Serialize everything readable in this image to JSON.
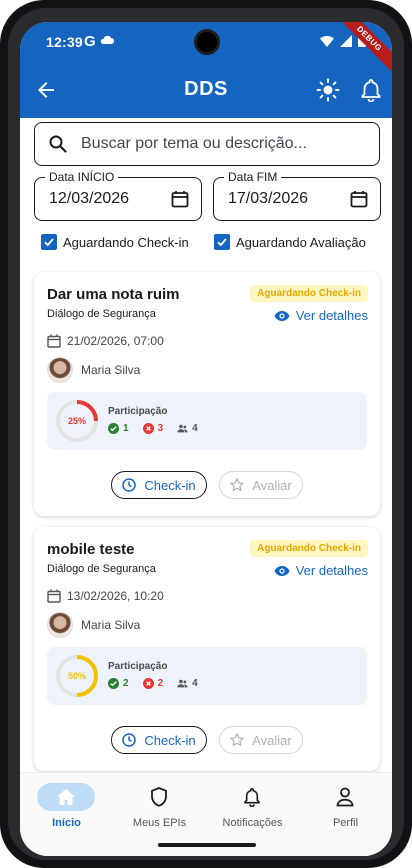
{
  "status_bar": {
    "time": "12:39",
    "carrier_letter": "G",
    "debug_label": "DEBUG"
  },
  "app_bar": {
    "title": "DDS"
  },
  "search": {
    "placeholder": "Buscar por tema ou descrição..."
  },
  "filters": {
    "start_date": {
      "label": "Data INÍCIO",
      "value": "12/03/2026"
    },
    "end_date": {
      "label": "Data FIM",
      "value": "17/03/2026"
    },
    "checkboxes": [
      {
        "label": "Aguardando Check-in",
        "checked": true
      },
      {
        "label": "Aguardando Avaliação",
        "checked": true
      }
    ]
  },
  "cards": [
    {
      "title": "Dar uma nota ruim",
      "subtitle": "Diálogo de Segurança",
      "status": "Aguardando Check-in",
      "details_label": "Ver detalhes",
      "datetime": "21/02/2026, 07:00",
      "person": "Maria Silva",
      "participation": {
        "title": "Participação",
        "percent_label": "25%",
        "percent": 25,
        "ring_color": "#e53935",
        "confirmed": "1",
        "declined": "3",
        "total": "4"
      },
      "checkin_label": "Check-in",
      "evaluate_label": "Avaliar"
    },
    {
      "title": "mobile teste",
      "subtitle": "Diálogo de Segurança",
      "status": "Aguardando Check-in",
      "details_label": "Ver detalhes",
      "datetime": "13/02/2026, 10:20",
      "person": "Maria Silva",
      "participation": {
        "title": "Participação",
        "percent_label": "50%",
        "percent": 50,
        "ring_color": "#f2c200",
        "confirmed": "2",
        "declined": "2",
        "total": "4"
      },
      "checkin_label": "Check-in",
      "evaluate_label": "Avaliar"
    }
  ],
  "bottom_nav": [
    {
      "label": "Início",
      "icon": "home-icon",
      "active": true
    },
    {
      "label": "Meus EPIs",
      "icon": "shield-icon",
      "active": false
    },
    {
      "label": "Notificações",
      "icon": "bell-icon",
      "active": false
    },
    {
      "label": "Perfil",
      "icon": "person-icon",
      "active": false
    }
  ],
  "colors": {
    "primary": "#1565c0",
    "badge_bg": "#fff7c2",
    "badge_text": "#e6a700",
    "success": "#2e7d32",
    "danger": "#e53935"
  }
}
